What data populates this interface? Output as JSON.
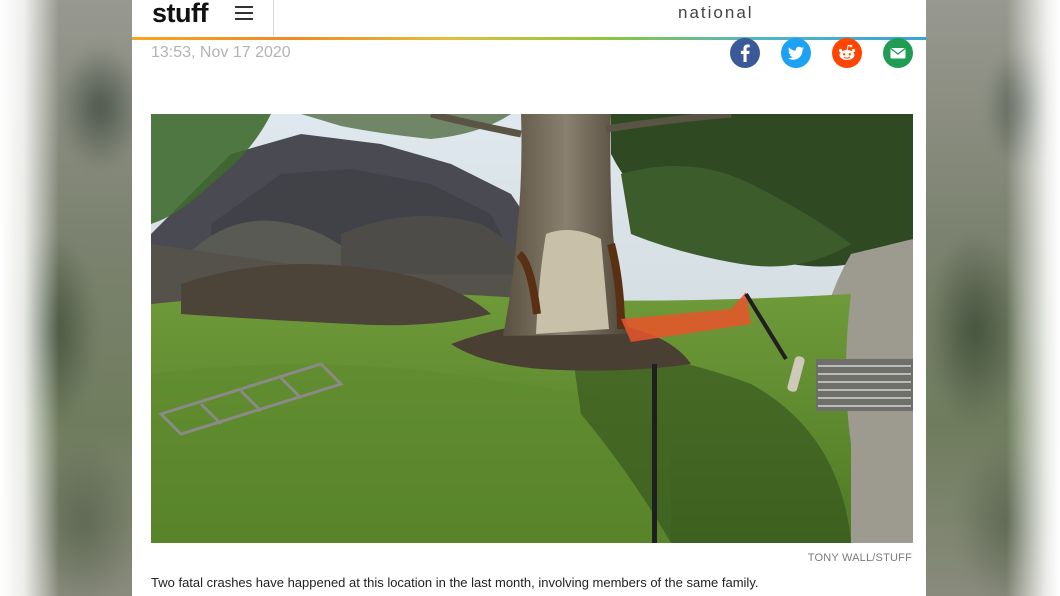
{
  "header": {
    "logo": "stuff",
    "section": "national"
  },
  "article": {
    "timestamp": "13:53, Nov 17 2020",
    "photo_credit": "TONY WALL/STUFF",
    "caption": "Two fatal crashes have happened at this location in the last month, involving members of the same family."
  },
  "share": {
    "items": [
      "facebook-icon",
      "twitter-icon",
      "reddit-icon",
      "email-icon"
    ]
  },
  "colors": {
    "facebook": "#3b5998",
    "twitter": "#1da1f2",
    "reddit": "#ff4500",
    "email": "#1f9d55"
  }
}
